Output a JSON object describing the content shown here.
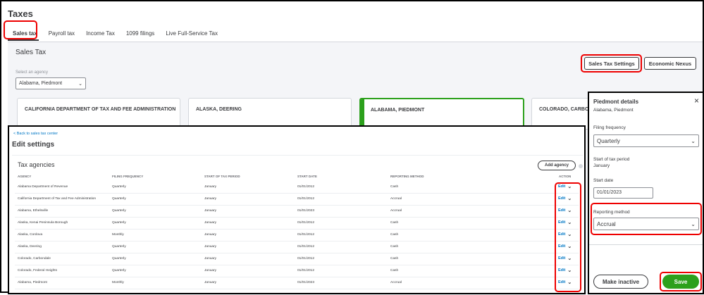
{
  "page": {
    "title": "Taxes"
  },
  "tabs": [
    {
      "label": "Sales tax"
    },
    {
      "label": "Payroll tax"
    },
    {
      "label": "Income Tax"
    },
    {
      "label": "1099 filings"
    },
    {
      "label": "Live Full-Service Tax"
    }
  ],
  "sales_tax": {
    "title": "Sales Tax",
    "agency_label": "Select an agency",
    "agency_value": "Alabama, Piedmont",
    "settings_button": "Sales Tax Settings",
    "nexus_button": "Economic Nexus",
    "cards": [
      {
        "label": "CALIFORNIA DEPARTMENT OF TAX AND FEE ADMINISTRATION"
      },
      {
        "label": "ALASKA, DEERING"
      },
      {
        "label": "ALABAMA, PIEDMONT"
      },
      {
        "label": "COLORADO, CARBONDALE"
      }
    ]
  },
  "edit_settings": {
    "back_link": "< Back to sales tax center",
    "title": "Edit settings",
    "table_title": "Tax agencies",
    "add_agency": "Add agency",
    "columns": [
      "AGENCY",
      "FILING FREQUENCY",
      "START OF TAX PERIOD",
      "START DATE",
      "REPORTING METHOD",
      "ACTION"
    ],
    "rows": [
      {
        "agency": "Alabama Department of Revenue",
        "frequency": "Quarterly",
        "period": "January",
        "date": "01/01/2012",
        "method": "Cash",
        "action": "Edit"
      },
      {
        "agency": "California Department of Tax and Fee Administration",
        "frequency": "Quarterly",
        "period": "January",
        "date": "01/01/2012",
        "method": "Accrual",
        "action": "Edit"
      },
      {
        "agency": "Alabama, Ethelsville",
        "frequency": "Quarterly",
        "period": "January",
        "date": "01/01/2023",
        "method": "Accrual",
        "action": "Edit"
      },
      {
        "agency": "Alaska, Kenai Peninsula Borough",
        "frequency": "Quarterly",
        "period": "January",
        "date": "01/01/2012",
        "method": "Cash",
        "action": "Edit"
      },
      {
        "agency": "Alaska, Cordova",
        "frequency": "Monthly",
        "period": "January",
        "date": "01/01/2012",
        "method": "Cash",
        "action": "Edit"
      },
      {
        "agency": "Alaska, Deering",
        "frequency": "Quarterly",
        "period": "January",
        "date": "01/01/2012",
        "method": "Cash",
        "action": "Edit"
      },
      {
        "agency": "Colorado, Carbondale",
        "frequency": "Quarterly",
        "period": "January",
        "date": "01/01/2012",
        "method": "Cash",
        "action": "Edit"
      },
      {
        "agency": "Colorado, Federal Heights",
        "frequency": "Quarterly",
        "period": "January",
        "date": "01/01/2012",
        "method": "Cash",
        "action": "Edit"
      },
      {
        "agency": "Alabama, Piedmont",
        "frequency": "Monthly",
        "period": "January",
        "date": "01/01/2023",
        "method": "Accrual",
        "action": "Edit"
      }
    ]
  },
  "details_panel": {
    "title": "Piedmont details",
    "subtitle": "Alabama, Piedmont",
    "filing_frequency_label": "Filing frequency",
    "filing_frequency_value": "Quarterly",
    "start_period_label": "Start of tax period",
    "start_period_value": "January",
    "start_date_label": "Start date",
    "start_date_value": "01/01/2023",
    "reporting_method_label": "Reporting method",
    "reporting_method_value": "Accrual",
    "make_inactive": "Make inactive",
    "save": "Save"
  },
  "colors": {
    "accent_green": "#2ca01c",
    "link_blue": "#0077c5",
    "highlight_red": "#e00000"
  },
  "icons": {
    "close": "close-icon",
    "chevron": "chevron-down-icon"
  }
}
